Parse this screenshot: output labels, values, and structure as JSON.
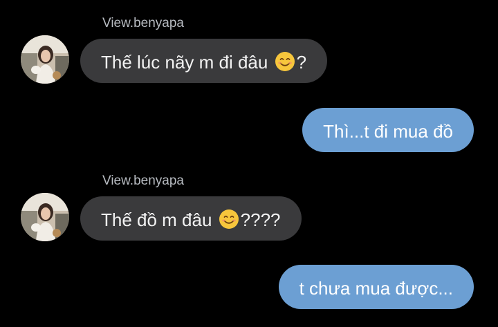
{
  "messages": [
    {
      "direction": "incoming",
      "sender": "View.benyapa",
      "text_before": "Thế lúc nãy m đi đâu",
      "emoji": "smiling-face-icon",
      "text_after": "?"
    },
    {
      "direction": "outgoing",
      "text": "Thì...t đi mua đồ"
    },
    {
      "direction": "incoming",
      "sender": "View.benyapa",
      "text_before": "Thế đồ m đâu",
      "emoji": "smiling-face-icon",
      "text_after": "????"
    },
    {
      "direction": "outgoing",
      "text": "t chưa mua được..."
    }
  ],
  "colors": {
    "background": "#000000",
    "incoming_bubble": "#3a3a3c",
    "outgoing_bubble": "#6c9fd3",
    "sender_name": "#b8bcc2"
  }
}
